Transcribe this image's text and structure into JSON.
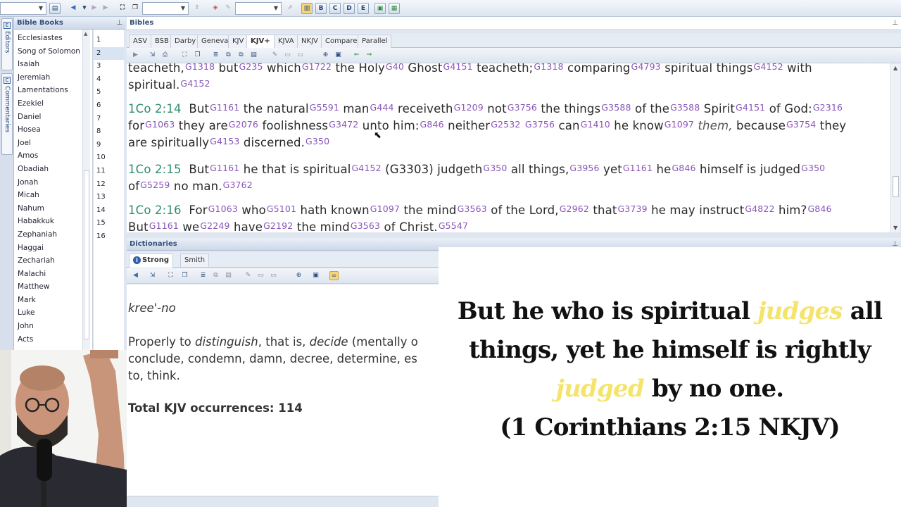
{
  "toolbar": {
    "zoom_value": "",
    "search_value": "",
    "verse_value": "",
    "layout_icons": [
      "B",
      "C",
      "D",
      "E"
    ]
  },
  "side_tabs": {
    "editors": "Editors",
    "commentaries": "Commentaries"
  },
  "books_panel": {
    "title": "Bible Books",
    "books": [
      "Ecclesiastes",
      "Song of Solomon",
      "Isaiah",
      "Jeremiah",
      "Lamentations",
      "Ezekiel",
      "Daniel",
      "Hosea",
      "Joel",
      "Amos",
      "Obadiah",
      "Jonah",
      "Micah",
      "Nahum",
      "Habakkuk",
      "Zephaniah",
      "Haggai",
      "Zechariah",
      "Malachi",
      "Matthew",
      "Mark",
      "Luke",
      "John",
      "Acts"
    ],
    "chapters": [
      "1",
      "2",
      "3",
      "4",
      "5",
      "6",
      "7",
      "8",
      "9",
      "10",
      "11",
      "12",
      "13",
      "14",
      "15",
      "16"
    ],
    "selected_chapter": "2"
  },
  "bibles_panel": {
    "title": "Bibles",
    "tabs": [
      "ASV",
      "BSB",
      "Darby",
      "Geneva",
      "KJV",
      "KJV+",
      "KJVA",
      "NKJV",
      "Compare",
      "Parallel"
    ],
    "active_tab": "KJV+"
  },
  "verses": {
    "l0": [
      [
        "teacheth,",
        "G1318"
      ],
      [
        "but",
        "G235"
      ],
      [
        "which",
        "G1722"
      ],
      [
        "the Holy",
        "G40"
      ],
      [
        "Ghost",
        "G4151"
      ],
      [
        "teacheth;",
        "G1318"
      ],
      [
        "comparing",
        "G4793"
      ],
      [
        "spiritual things",
        "G4152"
      ],
      [
        "with",
        ""
      ]
    ],
    "l1": [
      [
        "spiritual.",
        "G4152"
      ]
    ],
    "v14_ref": "1Co 2:14",
    "l2": [
      [
        "But",
        "G1161"
      ],
      [
        "the natural",
        "G5591"
      ],
      [
        "man",
        "G444"
      ],
      [
        "receiveth",
        "G1209"
      ],
      [
        "not",
        "G3756"
      ],
      [
        "the things",
        "G3588"
      ],
      [
        "of the",
        "G3588"
      ],
      [
        "Spirit",
        "G4151"
      ],
      [
        "of God:",
        "G2316"
      ]
    ],
    "l3": [
      [
        "for",
        "G1063"
      ],
      [
        "they are",
        "G2076"
      ],
      [
        "foolishness",
        "G3472"
      ],
      [
        "unto him:",
        "G846"
      ],
      [
        "neither",
        "G2532"
      ],
      [
        "",
        "G3756"
      ],
      [
        "can",
        "G1410"
      ],
      [
        "he know",
        "G1097"
      ],
      [
        "them,",
        "",
        true
      ],
      [
        "because",
        "G3754"
      ],
      [
        "they",
        ""
      ]
    ],
    "l4": [
      [
        "are spiritually",
        "G4153"
      ],
      [
        "discerned.",
        "G350"
      ]
    ],
    "v15_ref": "1Co 2:15",
    "l5": [
      [
        "But",
        "G1161"
      ],
      [
        "he that is spiritual",
        "G4152"
      ],
      [
        "(G3303)",
        ""
      ],
      [
        "judgeth",
        "G350"
      ],
      [
        "all things,",
        "G3956"
      ],
      [
        "yet",
        "G1161"
      ],
      [
        "he",
        "G846"
      ],
      [
        "himself is judged",
        "G350"
      ]
    ],
    "l6": [
      [
        "of",
        "G5259"
      ],
      [
        "no man.",
        "G3762"
      ]
    ],
    "v16_ref": "1Co 2:16",
    "l7": [
      [
        "For",
        "G1063"
      ],
      [
        "who",
        "G5101"
      ],
      [
        "hath known",
        "G1097"
      ],
      [
        "the mind",
        "G3563"
      ],
      [
        "of the Lord,",
        "G2962"
      ],
      [
        "that",
        "G3739"
      ],
      [
        "he may instruct",
        "G4822"
      ],
      [
        "him?",
        "G846"
      ]
    ],
    "l8": [
      [
        "But",
        "G1161"
      ],
      [
        "we",
        "G2249"
      ],
      [
        "have",
        "G2192"
      ],
      [
        "the mind",
        "G3563"
      ],
      [
        "of Christ.",
        "G5547"
      ]
    ]
  },
  "dictionaries_panel": {
    "title": "Dictionaries",
    "tabs": [
      "Strong",
      "Smith"
    ],
    "active_tab": "Strong",
    "pronunciation": "kree'-no",
    "def_line1_a": "Properly to ",
    "def_line1_b": "distinguish",
    "def_line1_c": ", that is, ",
    "def_line1_d": "decide",
    "def_line1_e": " (mentally o",
    "def_line2": "conclude, condemn, damn, decree, determine, es",
    "def_line3": "to, think.",
    "occurrences": "Total KJV occurrences: 114"
  },
  "overlay": {
    "line1_a": "But he who is spiritual ",
    "line1_hl": "judges",
    "line1_b": " all",
    "line2": "things, yet he himself is rightly",
    "line3_hl": "judged",
    "line3_b": " by no one.",
    "line4": "(1 Corinthians 2:15 NKJV)",
    "highlight_color": "#f5e46b"
  }
}
